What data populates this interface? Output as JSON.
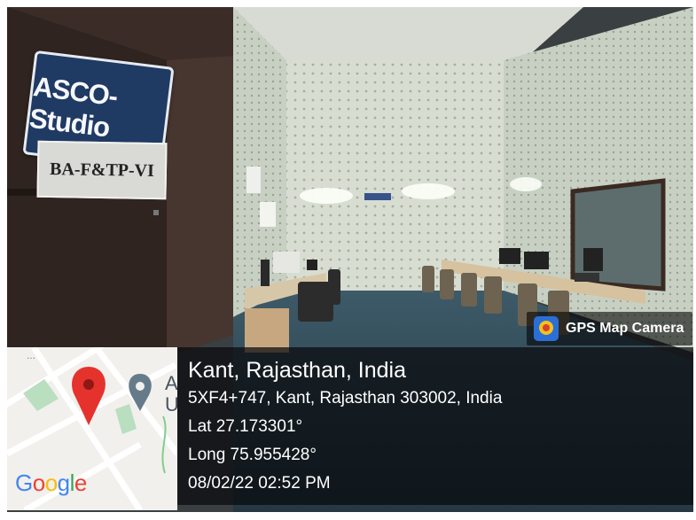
{
  "photo": {
    "sign_title": "ASCO-Studio",
    "sign_subtitle": "BA-F&TP-VI"
  },
  "overlay": {
    "app_badge": {
      "icon": "gps-map-camera-icon",
      "label": "GPS Map Camera"
    },
    "location_title": "Kant, Rajasthan, India",
    "address": "5XF4+747, Kant, Rajasthan 303002, India",
    "latitude": "Lat 27.173301°",
    "longitude": "Long 75.955428°",
    "datetime": "08/02/22 02:52 PM"
  },
  "map": {
    "logo": "Google",
    "dots": "...",
    "label_a": "A",
    "label_u": "U",
    "pin_color": "#e5322d",
    "secondary_pin_color": "#667b8a"
  }
}
